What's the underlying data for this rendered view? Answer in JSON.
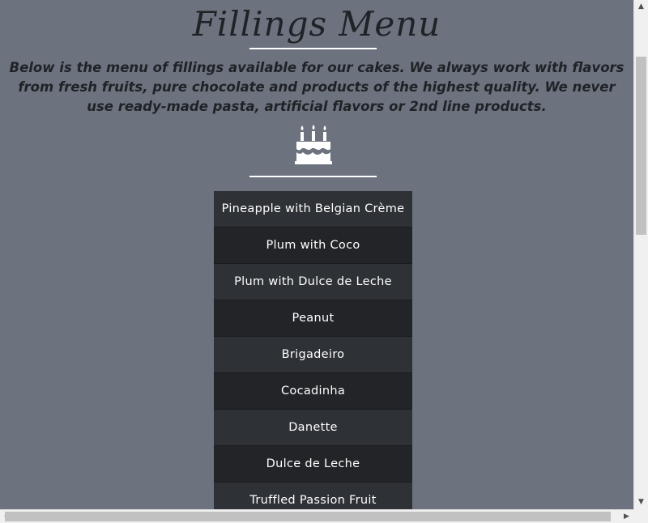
{
  "page": {
    "title": "Fillings Menu",
    "intro": "Below is the menu of fillings available for our cakes. We always work with flavors from fresh fruits, pure chocolate and products of the highest quality. We never use ready-made pasta, artificial flavors or 2nd line products.",
    "icon": "birthday-cake-icon"
  },
  "menu": {
    "items": [
      "Pineapple with Belgian Crème",
      "Plum with Coco",
      "Plum with Dulce de Leche",
      "Peanut",
      "Brigadeiro",
      "Cocadinha",
      "Danette",
      "Dulce de Leche",
      "Truffled Passion Fruit"
    ]
  },
  "colors": {
    "background": "#6c737e",
    "menu_odd": "#2e3136",
    "menu_even": "#222428",
    "text_dark": "#1f2226",
    "accent_line": "#ffffff"
  },
  "scrollbars": {
    "up_arrow": "▲",
    "down_arrow": "▼",
    "left_arrow": "◀",
    "right_arrow": "▶"
  }
}
